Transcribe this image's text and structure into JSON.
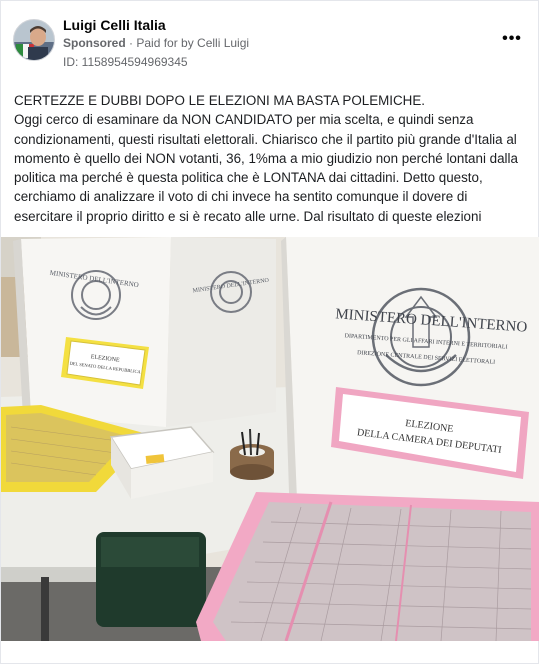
{
  "post": {
    "author": "Luigi Celli Italia",
    "sponsored": "Sponsored",
    "paid_for": "Paid for by Celli Luigi",
    "ad_id": "ID: 1158954594969345",
    "more_icon": "more-options-icon",
    "headline": "CERTEZZE E DUBBI DOPO LE ELEZIONI MA BASTA POLEMICHE.",
    "body": "Oggi cerco di esaminare da NON CANDIDATO per mia scelta, e quindi senza condizionamenti, questi risultati elettorali. Chiarisco che il partito più grande d'Italia al momento è quello dei NON votanti, 36, 1%ma a mio giudizio non perché lontani dalla politica ma perché è questa politica che è LONTANA dai cittadini. Detto questo, cerchiamo di analizzare il voto di chi invece ha sentito comunque il dovere di esercitare il proprio diritto e si è recato alle urne. Dal risultato di queste elezioni"
  },
  "photo": {
    "box_left_header": "MINISTERO DELL'INTERNO",
    "box_left_label_1": "ELEZIONE",
    "box_left_label_2": "DEL SENATO DELLA REPUBBLICA",
    "box_right_header": "MINISTERO DELL'INTERNO",
    "box_right_sub_1": "DIPARTIMENTO PER GLI AFFARI INTERNI E TERRITORIALI",
    "box_right_sub_2": "DIREZIONE CENTRALE DEI SERVIZI ELETTORALI",
    "box_right_label_1": "ELEZIONE",
    "box_right_label_2": "DELLA CAMERA DEI DEPUTATI"
  },
  "colors": {
    "text_primary": "#050505",
    "text_secondary": "#65676b",
    "ballot_pink": "#f2a7c3",
    "ballot_yellow": "#f3df3a"
  }
}
